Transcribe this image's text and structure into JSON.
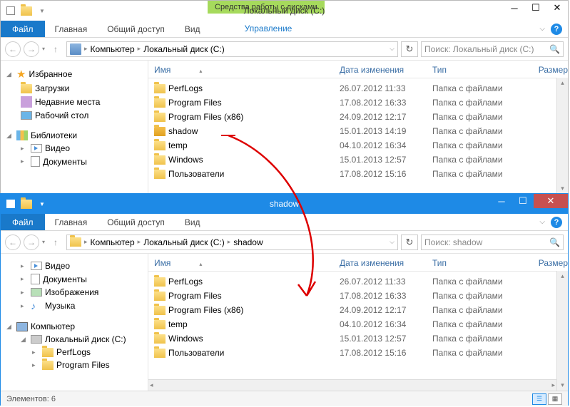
{
  "win1": {
    "context_tab": "Средства работы с дисками",
    "title": "Локальный диск (C:)",
    "tabs": {
      "file": "Файл",
      "home": "Главная",
      "share": "Общий доступ",
      "view": "Вид",
      "manage": "Управление"
    },
    "breadcrumb": [
      "Компьютер",
      "Локальный диск (C:)"
    ],
    "search_placeholder": "Поиск: Локальный диск (C:)",
    "sidebar": {
      "favorites": {
        "label": "Избранное",
        "items": [
          "Загрузки",
          "Недавние места",
          "Рабочий стол"
        ]
      },
      "libraries": {
        "label": "Библиотеки",
        "items": [
          "Видео",
          "Документы"
        ]
      }
    },
    "columns": {
      "name": "Имя",
      "date": "Дата изменения",
      "type": "Тип",
      "size": "Размер"
    },
    "rows": [
      {
        "name": "PerfLogs",
        "date": "26.07.2012 11:33",
        "type": "Папка с файлами"
      },
      {
        "name": "Program Files",
        "date": "17.08.2012 16:33",
        "type": "Папка с файлами"
      },
      {
        "name": "Program Files (x86)",
        "date": "24.09.2012 12:17",
        "type": "Папка с файлами"
      },
      {
        "name": "shadow",
        "date": "15.01.2013 14:19",
        "type": "Папка с файлами"
      },
      {
        "name": "temp",
        "date": "04.10.2012 16:34",
        "type": "Папка с файлами"
      },
      {
        "name": "Windows",
        "date": "15.01.2013 12:57",
        "type": "Папка с файлами"
      },
      {
        "name": "Пользователи",
        "date": "17.08.2012 15:16",
        "type": "Папка с файлами"
      }
    ]
  },
  "win2": {
    "title": "shadow",
    "tabs": {
      "file": "Файл",
      "home": "Главная",
      "share": "Общий доступ",
      "view": "Вид"
    },
    "breadcrumb": [
      "Компьютер",
      "Локальный диск (C:)",
      "shadow"
    ],
    "search_placeholder": "Поиск: shadow",
    "sidebar": {
      "libraries_items": [
        "Видео",
        "Документы",
        "Изображения",
        "Музыка"
      ],
      "computer": {
        "label": "Компьютер",
        "drive": "Локальный диск (C:)",
        "folders": [
          "PerfLogs",
          "Program Files"
        ]
      }
    },
    "columns": {
      "name": "Имя",
      "date": "Дата изменения",
      "type": "Тип",
      "size": "Размер"
    },
    "rows": [
      {
        "name": "PerfLogs",
        "date": "26.07.2012 11:33",
        "type": "Папка с файлами"
      },
      {
        "name": "Program Files",
        "date": "17.08.2012 16:33",
        "type": "Папка с файлами"
      },
      {
        "name": "Program Files (x86)",
        "date": "24.09.2012 12:17",
        "type": "Папка с файлами"
      },
      {
        "name": "temp",
        "date": "04.10.2012 16:34",
        "type": "Папка с файлами"
      },
      {
        "name": "Windows",
        "date": "15.01.2013 12:57",
        "type": "Папка с файлами"
      },
      {
        "name": "Пользователи",
        "date": "17.08.2012 15:16",
        "type": "Папка с файлами"
      }
    ],
    "status": "Элементов: 6"
  }
}
